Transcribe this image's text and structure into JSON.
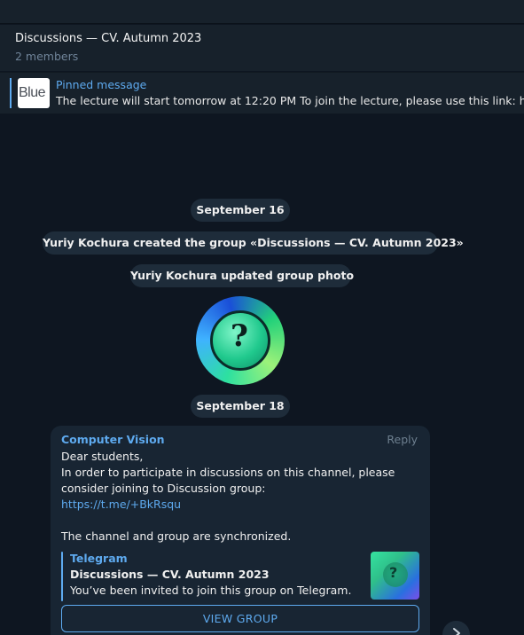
{
  "chat": {
    "title": "Discussions — CV. Autumn 2023",
    "members": "2 members"
  },
  "pinned": {
    "label": "Pinned message",
    "text": "The lecture will start tomorrow at 12:20 PM To join the lecture, please use this link: https://",
    "thumb_text": "Blue"
  },
  "service": {
    "date1": "September 16",
    "created": "Yuriy Kochura created the group «Discussions — CV. Autumn 2023»",
    "photo_updated": "Yuriy Kochura updated group photo",
    "date2": "September 18"
  },
  "message": {
    "author": "Computer Vision",
    "reply_label": "Reply",
    "lines": [
      "Dear students,",
      "In order to participate in discussions on this channel, please",
      "consider joining to Discussion group:"
    ],
    "link": "https://t.me/+BkRsqu",
    "footer": "The channel and group are synchronized.",
    "preview": {
      "site": "Telegram",
      "title": "Discussions — CV. Autumn 2023",
      "description": "You’ve been invited to join this group on Telegram."
    },
    "button_label": "VIEW GROUP"
  },
  "colors": {
    "background": "#0e1621",
    "header": "#17212b",
    "bubble": "#182533",
    "accent": "#5eaaef",
    "service_pill": "#1e2c3a"
  },
  "icons": {
    "scroll_down": "chevron-down-icon",
    "group_photo": "group-avatar"
  }
}
